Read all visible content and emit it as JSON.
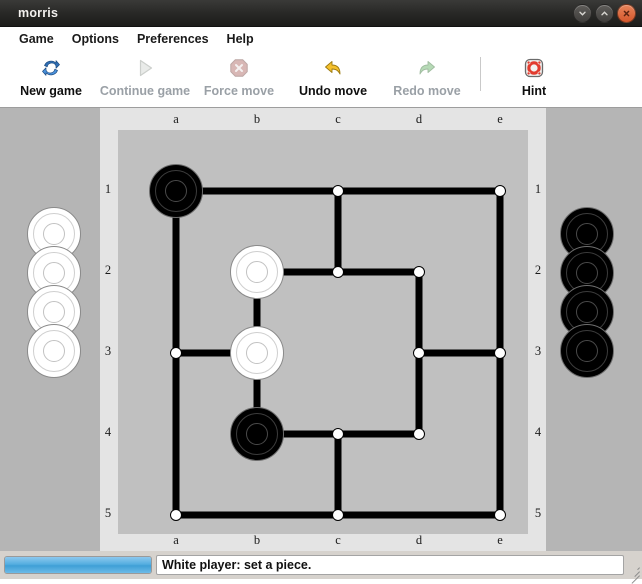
{
  "window": {
    "title": "morris",
    "buttons": [
      {
        "name": "minimize-button",
        "icon": "chevron-down-icon"
      },
      {
        "name": "maximize-button",
        "icon": "chevron-up-icon"
      },
      {
        "name": "close-button",
        "icon": "close-x-icon"
      }
    ]
  },
  "menubar": {
    "items": [
      {
        "label": "Game"
      },
      {
        "label": "Options"
      },
      {
        "label": "Preferences"
      },
      {
        "label": "Help"
      }
    ]
  },
  "toolbar": {
    "buttons": [
      {
        "label": "New game",
        "icon": "refresh-arrows-icon",
        "enabled": true
      },
      {
        "label": "Continue game",
        "icon": "play-triangle-icon",
        "enabled": false
      },
      {
        "label": "Force move",
        "icon": "stop-x-octagon-icon",
        "enabled": false
      },
      {
        "label": "Undo move",
        "icon": "undo-arrow-icon",
        "enabled": true
      },
      {
        "label": "Redo move",
        "icon": "redo-arrow-icon",
        "enabled": false
      },
      {
        "label": "Hint",
        "icon": "lifebuoy-icon",
        "enabled": true
      }
    ]
  },
  "board": {
    "column_labels": [
      "a",
      "b",
      "c",
      "d",
      "e"
    ],
    "row_labels": [
      "1",
      "2",
      "3",
      "4",
      "5"
    ],
    "colors": {
      "outer_background": "#b5b5b5",
      "board_frame": "#e4e4e4",
      "board_surface": "#c0c0c0",
      "line": "#000000",
      "node_fill": "#ffffff",
      "black_stone": "#000000",
      "white_stone": "#ffffff"
    },
    "points": [
      {
        "id": "a1",
        "col": 0,
        "row": 0,
        "occupant": "black"
      },
      {
        "id": "c1",
        "col": 2,
        "row": 0,
        "occupant": "empty"
      },
      {
        "id": "e1",
        "col": 4,
        "row": 0,
        "occupant": "empty"
      },
      {
        "id": "b2",
        "col": 1,
        "row": 1,
        "occupant": "white"
      },
      {
        "id": "c2",
        "col": 2,
        "row": 1,
        "occupant": "empty"
      },
      {
        "id": "d2",
        "col": 3,
        "row": 1,
        "occupant": "empty"
      },
      {
        "id": "a3",
        "col": 0,
        "row": 2,
        "occupant": "empty"
      },
      {
        "id": "b3",
        "col": 1,
        "row": 2,
        "occupant": "white"
      },
      {
        "id": "d3",
        "col": 3,
        "row": 2,
        "occupant": "empty"
      },
      {
        "id": "e3",
        "col": 4,
        "row": 2,
        "occupant": "empty"
      },
      {
        "id": "b4",
        "col": 1,
        "row": 3,
        "occupant": "black"
      },
      {
        "id": "c4",
        "col": 2,
        "row": 3,
        "occupant": "empty"
      },
      {
        "id": "d4",
        "col": 3,
        "row": 3,
        "occupant": "empty"
      },
      {
        "id": "a5",
        "col": 0,
        "row": 4,
        "occupant": "empty"
      },
      {
        "id": "c5",
        "col": 2,
        "row": 4,
        "occupant": "empty"
      },
      {
        "id": "e5",
        "col": 4,
        "row": 4,
        "occupant": "empty"
      }
    ],
    "edges": [
      [
        "a1",
        "c1"
      ],
      [
        "c1",
        "e1"
      ],
      [
        "a1",
        "a3"
      ],
      [
        "a3",
        "a5"
      ],
      [
        "e1",
        "e3"
      ],
      [
        "e3",
        "e5"
      ],
      [
        "a5",
        "c5"
      ],
      [
        "c5",
        "e5"
      ],
      [
        "b2",
        "c2"
      ],
      [
        "c2",
        "d2"
      ],
      [
        "b2",
        "b3"
      ],
      [
        "b3",
        "b4"
      ],
      [
        "d2",
        "d3"
      ],
      [
        "d3",
        "e3"
      ],
      [
        "a3",
        "b3"
      ],
      [
        "b4",
        "c4"
      ],
      [
        "c4",
        "d4"
      ],
      [
        "c1",
        "c2"
      ],
      [
        "d4",
        "d3"
      ],
      [
        "c4",
        "c5"
      ]
    ]
  },
  "reserves": {
    "white": {
      "count": 4,
      "side": "left",
      "color": "#ffffff"
    },
    "black": {
      "count": 4,
      "side": "right",
      "color": "#000000"
    }
  },
  "statusbar": {
    "progress_percent": 100,
    "message": "White player: set a piece."
  }
}
